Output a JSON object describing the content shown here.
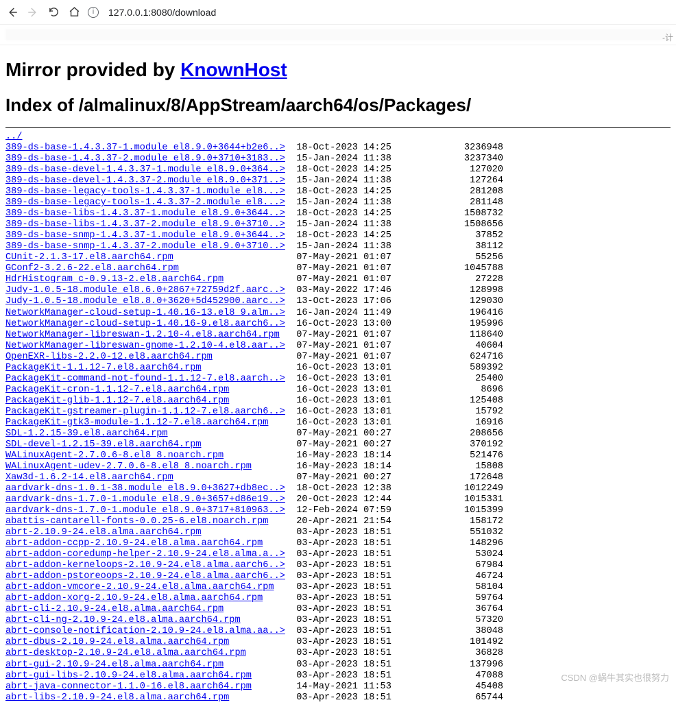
{
  "toolbar": {
    "url": "127.0.0.1:8080/download",
    "info_label": "i",
    "corner_text": "-计"
  },
  "heading": {
    "prefix": "Mirror provided by ",
    "link_text": "KnownHost",
    "index_title": "Index of /almalinux/8/AppStream/aarch64/os/Packages/"
  },
  "parent_link": "../",
  "name_col_width": 52,
  "date_col_width": 18,
  "size_col_width": 20,
  "files": [
    {
      "name": "389-ds-base-1.4.3.37-1.module_el8.9.0+3644+b2e6..>",
      "date": "18-Oct-2023 14:25",
      "size": "3236948"
    },
    {
      "name": "389-ds-base-1.4.3.37-2.module_el8.9.0+3710+3183..>",
      "date": "15-Jan-2024 11:38",
      "size": "3237340"
    },
    {
      "name": "389-ds-base-devel-1.4.3.37-1.module_el8.9.0+364..>",
      "date": "18-Oct-2023 14:25",
      "size": "127020"
    },
    {
      "name": "389-ds-base-devel-1.4.3.37-2.module_el8.9.0+371..>",
      "date": "15-Jan-2024 11:38",
      "size": "127264"
    },
    {
      "name": "389-ds-base-legacy-tools-1.4.3.37-1.module_el8...>",
      "date": "18-Oct-2023 14:25",
      "size": "281208"
    },
    {
      "name": "389-ds-base-legacy-tools-1.4.3.37-2.module_el8...>",
      "date": "15-Jan-2024 11:38",
      "size": "281148"
    },
    {
      "name": "389-ds-base-libs-1.4.3.37-1.module_el8.9.0+3644..>",
      "date": "18-Oct-2023 14:25",
      "size": "1508732"
    },
    {
      "name": "389-ds-base-libs-1.4.3.37-2.module_el8.9.0+3710..>",
      "date": "15-Jan-2024 11:38",
      "size": "1508656"
    },
    {
      "name": "389-ds-base-snmp-1.4.3.37-1.module_el8.9.0+3644..>",
      "date": "18-Oct-2023 14:25",
      "size": "37852"
    },
    {
      "name": "389-ds-base-snmp-1.4.3.37-2.module_el8.9.0+3710..>",
      "date": "15-Jan-2024 11:38",
      "size": "38112"
    },
    {
      "name": "CUnit-2.1.3-17.el8.aarch64.rpm",
      "date": "07-May-2021 01:07",
      "size": "55256"
    },
    {
      "name": "GConf2-3.2.6-22.el8.aarch64.rpm",
      "date": "07-May-2021 01:07",
      "size": "1045788"
    },
    {
      "name": "HdrHistogram_c-0.9.13-2.el8.aarch64.rpm",
      "date": "07-May-2021 01:07",
      "size": "27228"
    },
    {
      "name": "Judy-1.0.5-18.module_el8.6.0+2867+72759d2f.aarc..>",
      "date": "03-May-2022 17:46",
      "size": "128998"
    },
    {
      "name": "Judy-1.0.5-18.module_el8.8.0+3620+5d452900.aarc..>",
      "date": "13-Oct-2023 17:06",
      "size": "129030"
    },
    {
      "name": "NetworkManager-cloud-setup-1.40.16-13.el8_9.alm..>",
      "date": "16-Jan-2024 11:49",
      "size": "196416"
    },
    {
      "name": "NetworkManager-cloud-setup-1.40.16-9.el8.aarch6..>",
      "date": "16-Oct-2023 13:00",
      "size": "195996"
    },
    {
      "name": "NetworkManager-libreswan-1.2.10-4.el8.aarch64.rpm",
      "date": "07-May-2021 01:07",
      "size": "118640"
    },
    {
      "name": "NetworkManager-libreswan-gnome-1.2.10-4.el8.aar..>",
      "date": "07-May-2021 01:07",
      "size": "40604"
    },
    {
      "name": "OpenEXR-libs-2.2.0-12.el8.aarch64.rpm",
      "date": "07-May-2021 01:07",
      "size": "624716"
    },
    {
      "name": "PackageKit-1.1.12-7.el8.aarch64.rpm",
      "date": "16-Oct-2023 13:01",
      "size": "589392"
    },
    {
      "name": "PackageKit-command-not-found-1.1.12-7.el8.aarch..>",
      "date": "16-Oct-2023 13:01",
      "size": "25400"
    },
    {
      "name": "PackageKit-cron-1.1.12-7.el8.aarch64.rpm",
      "date": "16-Oct-2023 13:01",
      "size": "8696"
    },
    {
      "name": "PackageKit-glib-1.1.12-7.el8.aarch64.rpm",
      "date": "16-Oct-2023 13:01",
      "size": "125408"
    },
    {
      "name": "PackageKit-gstreamer-plugin-1.1.12-7.el8.aarch6..>",
      "date": "16-Oct-2023 13:01",
      "size": "15792"
    },
    {
      "name": "PackageKit-gtk3-module-1.1.12-7.el8.aarch64.rpm",
      "date": "16-Oct-2023 13:01",
      "size": "16916"
    },
    {
      "name": "SDL-1.2.15-39.el8.aarch64.rpm",
      "date": "07-May-2021 00:27",
      "size": "208656"
    },
    {
      "name": "SDL-devel-1.2.15-39.el8.aarch64.rpm",
      "date": "07-May-2021 00:27",
      "size": "370192"
    },
    {
      "name": "WALinuxAgent-2.7.0.6-8.el8_8.noarch.rpm",
      "date": "16-May-2023 18:14",
      "size": "521476"
    },
    {
      "name": "WALinuxAgent-udev-2.7.0.6-8.el8_8.noarch.rpm",
      "date": "16-May-2023 18:14",
      "size": "15808"
    },
    {
      "name": "Xaw3d-1.6.2-14.el8.aarch64.rpm",
      "date": "07-May-2021 00:27",
      "size": "172648"
    },
    {
      "name": "aardvark-dns-1.0.1-38.module_el8.9.0+3627+db8ec..>",
      "date": "18-Oct-2023 12:38",
      "size": "1012249"
    },
    {
      "name": "aardvark-dns-1.7.0-1.module_el8.9.0+3657+d86e19..>",
      "date": "20-Oct-2023 12:44",
      "size": "1015331"
    },
    {
      "name": "aardvark-dns-1.7.0-1.module_el8.9.0+3717+810963..>",
      "date": "12-Feb-2024 07:59",
      "size": "1015399"
    },
    {
      "name": "abattis-cantarell-fonts-0.0.25-6.el8.noarch.rpm",
      "date": "20-Apr-2021 21:54",
      "size": "158172"
    },
    {
      "name": "abrt-2.10.9-24.el8.alma.aarch64.rpm",
      "date": "03-Apr-2023 18:51",
      "size": "551032"
    },
    {
      "name": "abrt-addon-ccpp-2.10.9-24.el8.alma.aarch64.rpm",
      "date": "03-Apr-2023 18:51",
      "size": "148296"
    },
    {
      "name": "abrt-addon-coredump-helper-2.10.9-24.el8.alma.a..>",
      "date": "03-Apr-2023 18:51",
      "size": "53024"
    },
    {
      "name": "abrt-addon-kerneloops-2.10.9-24.el8.alma.aarch6..>",
      "date": "03-Apr-2023 18:51",
      "size": "67984"
    },
    {
      "name": "abrt-addon-pstoreoops-2.10.9-24.el8.alma.aarch6..>",
      "date": "03-Apr-2023 18:51",
      "size": "46724"
    },
    {
      "name": "abrt-addon-vmcore-2.10.9-24.el8.alma.aarch64.rpm",
      "date": "03-Apr-2023 18:51",
      "size": "58104"
    },
    {
      "name": "abrt-addon-xorg-2.10.9-24.el8.alma.aarch64.rpm",
      "date": "03-Apr-2023 18:51",
      "size": "59764"
    },
    {
      "name": "abrt-cli-2.10.9-24.el8.alma.aarch64.rpm",
      "date": "03-Apr-2023 18:51",
      "size": "36764"
    },
    {
      "name": "abrt-cli-ng-2.10.9-24.el8.alma.aarch64.rpm",
      "date": "03-Apr-2023 18:51",
      "size": "57320"
    },
    {
      "name": "abrt-console-notification-2.10.9-24.el8.alma.aa..>",
      "date": "03-Apr-2023 18:51",
      "size": "38048"
    },
    {
      "name": "abrt-dbus-2.10.9-24.el8.alma.aarch64.rpm",
      "date": "03-Apr-2023 18:51",
      "size": "101492"
    },
    {
      "name": "abrt-desktop-2.10.9-24.el8.alma.aarch64.rpm",
      "date": "03-Apr-2023 18:51",
      "size": "36828"
    },
    {
      "name": "abrt-gui-2.10.9-24.el8.alma.aarch64.rpm",
      "date": "03-Apr-2023 18:51",
      "size": "137996"
    },
    {
      "name": "abrt-gui-libs-2.10.9-24.el8.alma.aarch64.rpm",
      "date": "03-Apr-2023 18:51",
      "size": "47088"
    },
    {
      "name": "abrt-java-connector-1.1.0-16.el8.aarch64.rpm",
      "date": "14-May-2021 11:53",
      "size": "45408"
    },
    {
      "name": "abrt-libs-2.10.9-24.el8.alma.aarch64.rpm",
      "date": "03-Apr-2023 18:51",
      "size": "65744"
    }
  ],
  "watermark": "CSDN @蜗牛其实也很努力"
}
